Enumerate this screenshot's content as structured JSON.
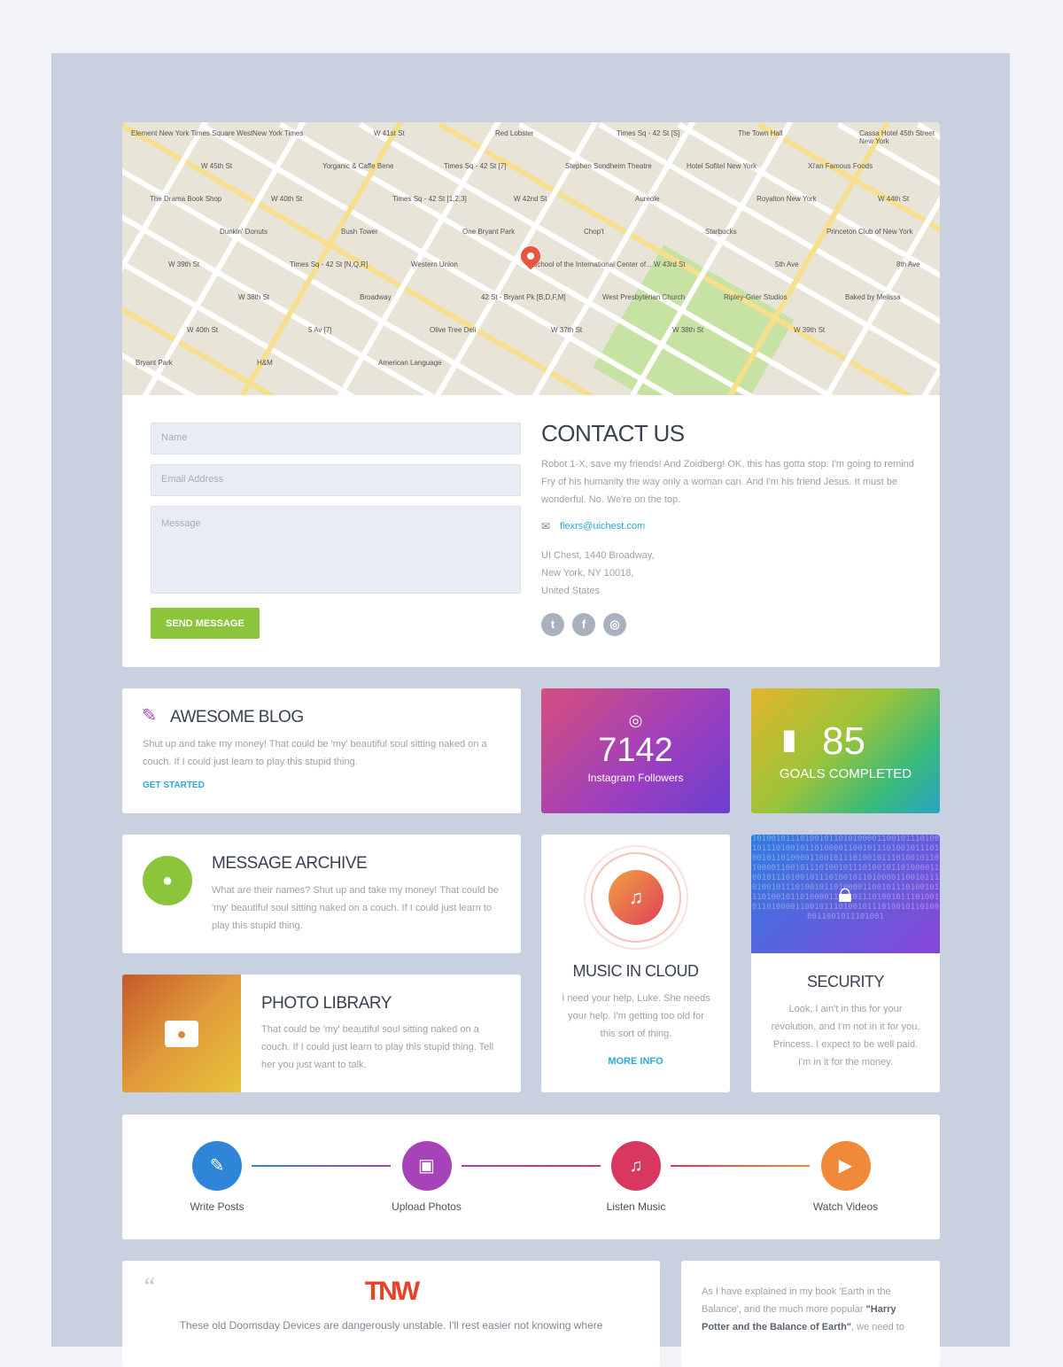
{
  "map": {
    "labels": [
      "Element New York Times Square West",
      "New York Times",
      "W 41st St",
      "Red Lobster",
      "Times Sq - 42 St [S]",
      "The Town Hall",
      "Cassa Hotel 45th Street New York",
      "W 45th St",
      "Yorganic & Caffe Bene",
      "Times Sq - 42 St [7]",
      "Stephen Sondheim Theatre",
      "Hotel Sofitel New York",
      "Xi'an Famous Foods",
      "The Drama Book Shop",
      "W 40th St",
      "Times Sq - 42 St [1,2,3]",
      "W 42nd St",
      "Aureole",
      "Royalton New York",
      "W 44th St",
      "Dunkin' Donuts",
      "Bush Tower",
      "One Bryant Park",
      "Chop't",
      "Starbucks",
      "Princeton Club of New York",
      "W 39th St",
      "Times Sq - 42 St [N,Q,R]",
      "Western Union",
      "School of the International Center of...",
      "W 43rd St",
      "5th Ave",
      "8th Ave",
      "W 38th St",
      "Broadway",
      "42 St - Bryant Pk [B,D,F,M]",
      "West Presbyterian Church",
      "Ripley-Grier Studios",
      "Baked by Melissa",
      "W 40th St",
      "5 Av [7]",
      "Olive Tree Deli",
      "W 37th St",
      "W 38th St",
      "W 39th St",
      "Bryant Park",
      "H&M",
      "American Language"
    ],
    "park_color": "#c6e3a4",
    "pin_color": "#e9553f"
  },
  "form": {
    "name_placeholder": "Name",
    "email_placeholder": "Email Address",
    "message_placeholder": "Message",
    "send_label": "SEND MESSAGE",
    "send_color": "#8cc43c"
  },
  "contact": {
    "title": "CONTACT US",
    "body": "Robot 1-X, save my friends! And Zoidberg! OK, this has gotta stop. I'm going to remind Fry of his humanity the way only a woman can. And I'm his friend Jesus. It must be wonderful. No. We're on the top.",
    "email": "flexrs@uichest.com",
    "address": [
      "UI Chest, 1440 Broadway,",
      "New York, NY 10018,",
      "United States"
    ],
    "social": [
      {
        "icon": "twitter-icon",
        "glyph": "t"
      },
      {
        "icon": "facebook-icon",
        "glyph": "f"
      },
      {
        "icon": "instagram-icon",
        "glyph": "◎"
      }
    ]
  },
  "blog": {
    "title": "AWESOME BLOG",
    "body": "Shut up and take my money! That could be 'my' beautiful soul sitting naked on a couch. If I could just learn to play this stupid thing.",
    "link": "GET STARTED",
    "icon_color": "#a347b8",
    "link_color": "#2aa9d6"
  },
  "instagram": {
    "count": "7142",
    "label": "Instagram Followers"
  },
  "goals": {
    "count": "85",
    "label": "GOALS COMPLETED"
  },
  "archive": {
    "title": "MESSAGE ARCHIVE",
    "body": "What are their names? Shut up and take my money! That could be 'my' beautiful soul sitting naked on a couch. If I could just learn to play this stupid thing.",
    "icon_color": "#8cc43c"
  },
  "photo": {
    "title": "PHOTO LIBRARY",
    "body": "That could be 'my' beautiful soul sitting naked on a couch. If I could just learn to play this stupid thing. Tell her you just want to talk."
  },
  "music": {
    "title": "MUSIC IN CLOUD",
    "body": "I need your help, Luke. She needs your help. I'm getting too old for this sort of thing.",
    "link": "MORE INFO"
  },
  "security": {
    "title": "SECURITY",
    "body": "Look, I ain't in this for your revolution, and I'm not in it for you, Princess. I expect to be well paid. I'm in it for the money.",
    "binary": "1010010111010010110101000011001011101001011101001011010000110010111010010111010010110100001100101110100101110100101101000011001011101001011101001011010000110010111010010111010010110100001100101110100101110100101101000011001011101001011101001011010000110010111010010111010010110100001100101110100101110100101101000011001011101001"
  },
  "timeline": {
    "steps": [
      {
        "label": "Write Posts",
        "icon": "edit-icon",
        "glyph": "✎",
        "color": "#2f86d9"
      },
      {
        "label": "Upload Photos",
        "icon": "image-icon",
        "glyph": "▣",
        "color": "#a743b8"
      },
      {
        "label": "Listen Music",
        "icon": "music-icon",
        "glyph": "♫",
        "color": "#d8375f"
      },
      {
        "label": "Watch Videos",
        "icon": "video-icon",
        "glyph": "▶",
        "color": "#f08a3a"
      }
    ]
  },
  "testimonial": {
    "logo": "TNW",
    "quote_mark": "“",
    "body": "These old Doomsday Devices are dangerously unstable. I'll rest easier not knowing where"
  },
  "side_quote": {
    "pre": "As I have explained in my book 'Earth in the Balance', and the much more popular ",
    "bold": "\"Harry Potter and the Balance of Earth\"",
    "post": ", we need to"
  }
}
